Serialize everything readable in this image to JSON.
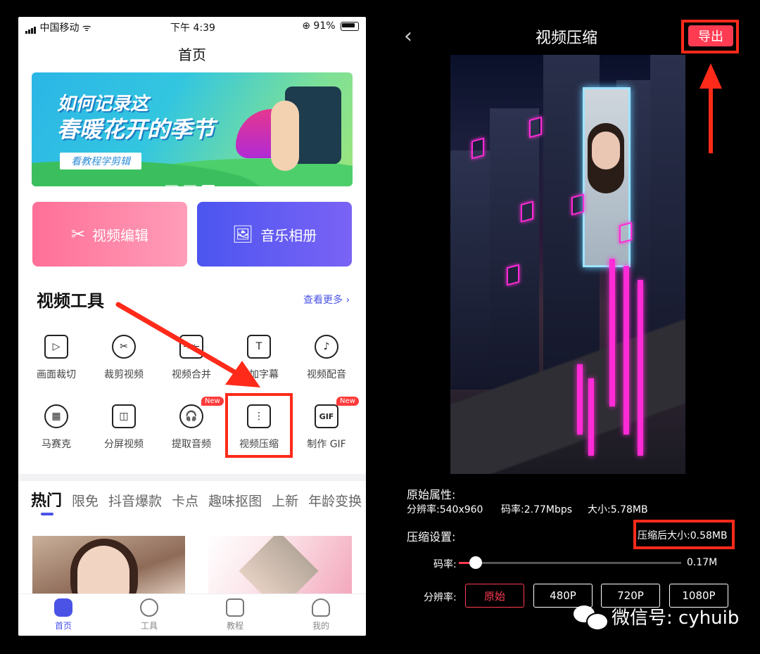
{
  "left_app": {
    "status": {
      "carrier": "中国移动",
      "time": "下午 4:39",
      "battery": "91%"
    },
    "title": "首页",
    "banner": {
      "line1": "如何记录这",
      "line2": "春暖花开的季节",
      "tag": "看教程学剪辑"
    },
    "cards": [
      {
        "label": "视频编辑",
        "icon": "scissors-icon"
      },
      {
        "label": "音乐相册",
        "icon": "image-icon"
      }
    ],
    "section_title": "视频工具",
    "more_label": "查看更多",
    "tools_row1": [
      {
        "label": "画面裁切",
        "icon": "crop-icon"
      },
      {
        "label": "裁剪视频",
        "icon": "scissors-circle-icon"
      },
      {
        "label": "视频合并",
        "icon": "merge-icon"
      },
      {
        "label": "添加字幕",
        "icon": "subtitle-icon"
      },
      {
        "label": "视频配音",
        "icon": "dubbing-icon"
      }
    ],
    "tools_row2": [
      {
        "label": "马赛克",
        "icon": "mosaic-icon"
      },
      {
        "label": "分屏视频",
        "icon": "split-screen-icon"
      },
      {
        "label": "提取音频",
        "icon": "headphones-icon",
        "badge": "New"
      },
      {
        "label": "视频压缩",
        "icon": "zip-icon"
      },
      {
        "label": "制作 GIF",
        "icon": "gif-icon",
        "badge": "New"
      }
    ],
    "tabs": [
      "热门",
      "限免",
      "抖音爆款",
      "卡点",
      "趣味抠图",
      "上新",
      "年龄变换"
    ],
    "bottom_nav": [
      "首页",
      "工具",
      "教程",
      "我的"
    ]
  },
  "right_app": {
    "title": "视频压缩",
    "export_label": "导出",
    "original_heading": "原始属性:",
    "resolution_text": "分辨率:540x960",
    "bitrate_text": "码率:2.77Mbps",
    "size_text": "大小:5.78MB",
    "settings_heading": "压缩设置:",
    "compressed_size": "压缩后大小:0.58MB",
    "bitrate_label": "码率:",
    "bitrate_value": "0.17M",
    "bitrate_fraction": 0.03,
    "resolution_label": "分辨率:",
    "resolution_options": [
      "原始",
      "480P",
      "720P",
      "1080P"
    ],
    "selected_resolution": "原始"
  },
  "watermark": "微信号: cyhuib",
  "colors": {
    "accent_blue": "#4a53e6",
    "accent_red": "#ff3b52",
    "annotation_red": "#ff2a1a"
  }
}
